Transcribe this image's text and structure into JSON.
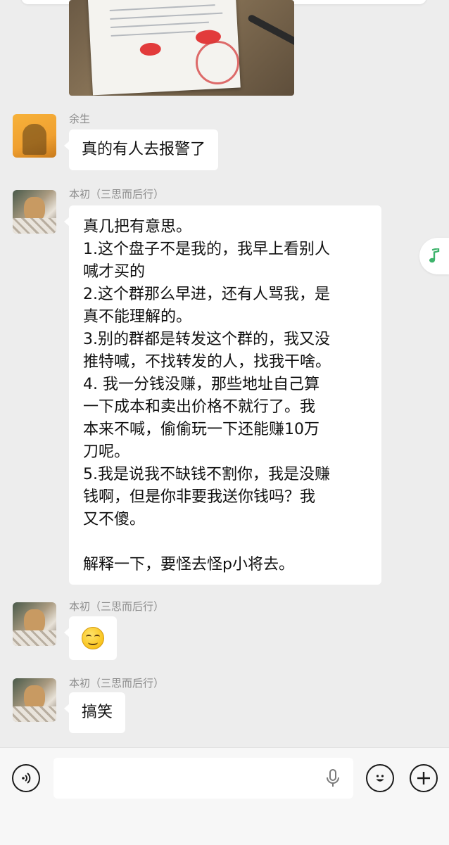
{
  "messages": [
    {
      "sender": "余生",
      "text": "真的有人去报警了"
    },
    {
      "sender": "本初（三思而后行）",
      "text": "真几把有意思。\n1.这个盘子不是我的，我早上看别人\n喊才买的\n2.这个群那么早进，还有人骂我，是\n真不能理解的。\n3.别的群都是转发这个群的，我又没\n推特喊，不找转发的人，找我干啥。\n4. 我一分钱没赚，那些地址自己算\n一下成本和卖出价格不就行了。我\n本来不喊，偷偷玩一下还能赚10万\n刀呢。\n5.我是说我不缺钱不割你，我是没赚\n钱啊，但是你非要我送你钱吗？我\n又不傻。\n\n解释一下，要怪去怪p小将去。"
    },
    {
      "sender": "本初（三思而后行）",
      "emoji": "sneaky-smile-emoji"
    },
    {
      "sender": "本初（三思而后行）",
      "text": "搞笑"
    }
  ],
  "icons": {
    "voice": "voice-input-icon",
    "mic": "microphone-icon",
    "emoji": "emoji-icon",
    "plus": "plus-icon",
    "music": "music-note-icon"
  },
  "colors": {
    "background": "#ededed",
    "bubble": "#ffffff",
    "music_accent": "#3db36b"
  }
}
